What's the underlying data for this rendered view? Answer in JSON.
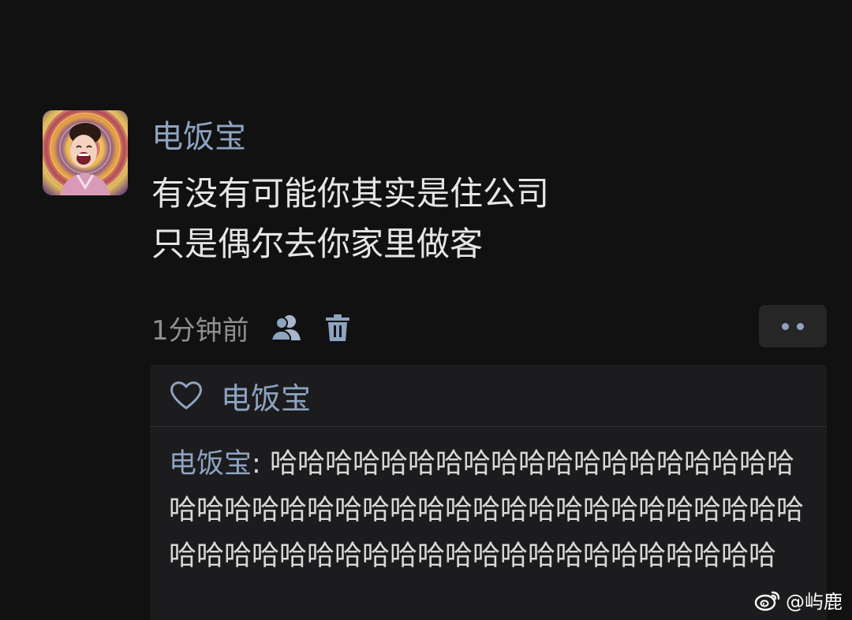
{
  "post": {
    "author": "电饭宝",
    "text_line1": "有没有可能你其实是住公司",
    "text_line2": "只是偶尔去你家里做客",
    "timestamp": "1分钟前"
  },
  "likes": {
    "name": "电饭宝"
  },
  "comment": {
    "author": "电饭宝",
    "separator": ": ",
    "text": "哈哈哈哈哈哈哈哈哈哈哈哈哈哈哈哈哈哈哈哈哈哈哈哈哈哈哈哈哈哈哈哈哈哈哈哈哈哈哈哈哈哈哈哈哈哈哈哈哈哈哈哈哈哈哈哈哈哈哈哈哈哈哈哈"
  },
  "watermark": {
    "text": "@屿鹿"
  },
  "icons": {
    "friends": "friends-icon",
    "delete": "trash-icon",
    "more": "more-icon",
    "like": "heart-icon",
    "weibo": "weibo-logo-icon"
  },
  "colors": {
    "background": "#111111",
    "name_blue": "#8ea3c2",
    "panel": "#1c1c1e",
    "text": "#e6e6e6",
    "meta_gray": "#8f8f8f"
  }
}
